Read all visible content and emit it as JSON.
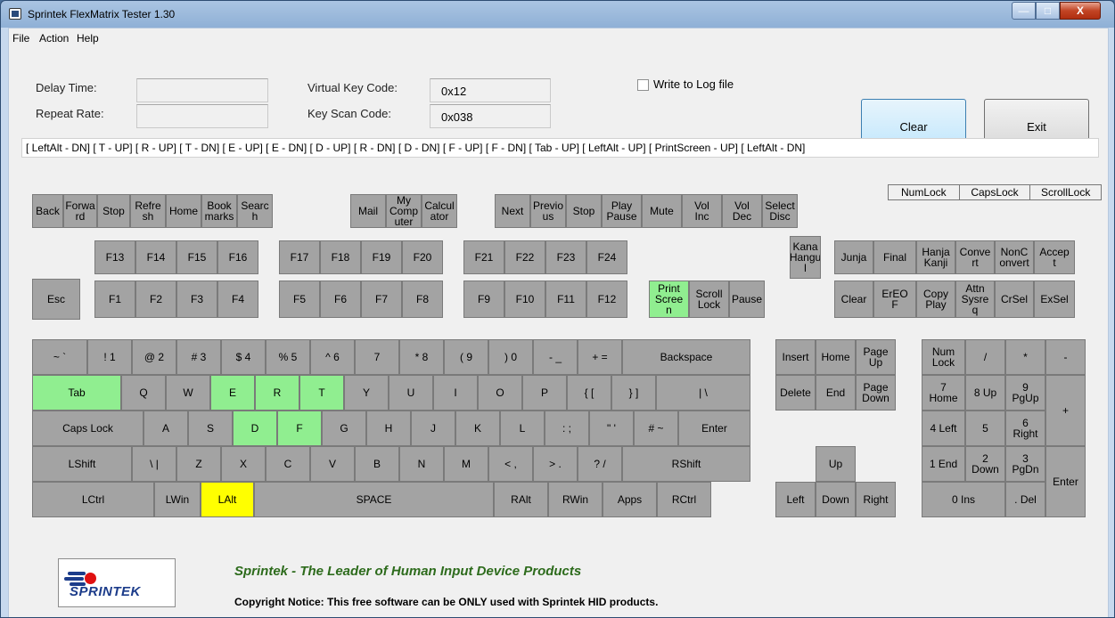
{
  "window": {
    "title": "Sprintek FlexMatrix Tester 1.30",
    "min": "—",
    "max": "□",
    "close": "X"
  },
  "menu": {
    "file": "File",
    "action": "Action",
    "help": "Help"
  },
  "fields": {
    "delay_label": "Delay Time:",
    "delay_value": "",
    "repeat_label": "Repeat Rate:",
    "repeat_value": "",
    "vkey_label": "Virtual Key Code:",
    "vkey_value": "0x12",
    "scan_label": "Key Scan Code:",
    "scan_value": "0x038"
  },
  "log": {
    "label": "Write to Log file",
    "checked": false
  },
  "buttons": {
    "clear": "Clear",
    "exit": "Exit"
  },
  "history": "[ LeftAlt - DN] [ T - UP] [ R - UP] [ T - DN] [ E - UP] [ E - DN] [ D - UP] [ R - DN] [ D - DN] [ F - UP] [ F - DN] [ Tab - UP] [ LeftAlt - UP] [ PrintScreen - UP] [ LeftAlt - DN]",
  "locks": [
    "NumLock",
    "CapsLock",
    "ScrollLock"
  ],
  "footer": {
    "logo_text": "SPRINTEK",
    "tagline": "Sprintek - The Leader of Human Input Device Products",
    "copyright": "Copyright Notice: This free software can be ONLY used with Sprintek HID products."
  },
  "keys": [
    {
      "id": "back",
      "label": "Back",
      "state": "up"
    },
    {
      "id": "forward",
      "label": "Forwa\nrd",
      "state": "up"
    },
    {
      "id": "stop1",
      "label": "Stop",
      "state": "up"
    },
    {
      "id": "refresh",
      "label": "Refre\nsh",
      "state": "up"
    },
    {
      "id": "home-m",
      "label": "Home",
      "state": "up"
    },
    {
      "id": "bookmarks",
      "label": "Book\nmarks",
      "state": "up"
    },
    {
      "id": "search",
      "label": "Searc\nh",
      "state": "up"
    },
    {
      "id": "mail",
      "label": "Mail",
      "state": "up"
    },
    {
      "id": "mycomputer",
      "label": "My\nComp\nuter",
      "state": "up"
    },
    {
      "id": "calculator",
      "label": "Calcul\nator",
      "state": "up"
    },
    {
      "id": "next",
      "label": "Next",
      "state": "up"
    },
    {
      "id": "previous",
      "label": "Previo\nus",
      "state": "up"
    },
    {
      "id": "stop2",
      "label": "Stop",
      "state": "up"
    },
    {
      "id": "playpause",
      "label": "Play\nPause",
      "state": "up"
    },
    {
      "id": "mute",
      "label": "Mute",
      "state": "up"
    },
    {
      "id": "volinc",
      "label": "Vol\nInc",
      "state": "up"
    },
    {
      "id": "voldec",
      "label": "Vol\nDec",
      "state": "up"
    },
    {
      "id": "selectdisc",
      "label": "Select\nDisc",
      "state": "up"
    },
    {
      "id": "f13",
      "label": "F13",
      "state": "up"
    },
    {
      "id": "f14",
      "label": "F14",
      "state": "up"
    },
    {
      "id": "f15",
      "label": "F15",
      "state": "up"
    },
    {
      "id": "f16",
      "label": "F16",
      "state": "up"
    },
    {
      "id": "f17",
      "label": "F17",
      "state": "up"
    },
    {
      "id": "f18",
      "label": "F18",
      "state": "up"
    },
    {
      "id": "f19",
      "label": "F19",
      "state": "up"
    },
    {
      "id": "f20",
      "label": "F20",
      "state": "up"
    },
    {
      "id": "f21",
      "label": "F21",
      "state": "up"
    },
    {
      "id": "f22",
      "label": "F22",
      "state": "up"
    },
    {
      "id": "f23",
      "label": "F23",
      "state": "up"
    },
    {
      "id": "f24",
      "label": "F24",
      "state": "up"
    },
    {
      "id": "kana",
      "label": "Kana\nHangu\nl",
      "state": "up"
    },
    {
      "id": "junja",
      "label": "Junja",
      "state": "up"
    },
    {
      "id": "final",
      "label": "Final",
      "state": "up"
    },
    {
      "id": "hanja",
      "label": "Hanja\nKanji",
      "state": "up"
    },
    {
      "id": "convert",
      "label": "Conve\nrt",
      "state": "up"
    },
    {
      "id": "nonconvert",
      "label": "NonC\nonvert",
      "state": "up"
    },
    {
      "id": "accept",
      "label": "Accep\nt",
      "state": "up"
    },
    {
      "id": "esc",
      "label": "Esc",
      "state": "up"
    },
    {
      "id": "f1",
      "label": "F1",
      "state": "up"
    },
    {
      "id": "f2",
      "label": "F2",
      "state": "up"
    },
    {
      "id": "f3",
      "label": "F3",
      "state": "up"
    },
    {
      "id": "f4",
      "label": "F4",
      "state": "up"
    },
    {
      "id": "f5",
      "label": "F5",
      "state": "up"
    },
    {
      "id": "f6",
      "label": "F6",
      "state": "up"
    },
    {
      "id": "f7",
      "label": "F7",
      "state": "up"
    },
    {
      "id": "f8",
      "label": "F8",
      "state": "up"
    },
    {
      "id": "f9",
      "label": "F9",
      "state": "up"
    },
    {
      "id": "f10",
      "label": "F10",
      "state": "up"
    },
    {
      "id": "f11",
      "label": "F11",
      "state": "up"
    },
    {
      "id": "f12",
      "label": "F12",
      "state": "up"
    },
    {
      "id": "printscreen",
      "label": "Print\nScree\nn",
      "state": "down"
    },
    {
      "id": "scrolllock",
      "label": "Scroll\nLock",
      "state": "up"
    },
    {
      "id": "pause",
      "label": "Pause",
      "state": "up"
    },
    {
      "id": "clearkey",
      "label": "Clear",
      "state": "up"
    },
    {
      "id": "ereof",
      "label": "ErEO\nF",
      "state": "up"
    },
    {
      "id": "copyplay",
      "label": "Copy\nPlay",
      "state": "up"
    },
    {
      "id": "attn",
      "label": "Attn\nSysre\nq",
      "state": "up"
    },
    {
      "id": "crsel",
      "label": "CrSel",
      "state": "up"
    },
    {
      "id": "exsel",
      "label": "ExSel",
      "state": "up"
    },
    {
      "id": "tilde",
      "label": "~ `",
      "state": "up"
    },
    {
      "id": "k1",
      "label": "! 1",
      "state": "up"
    },
    {
      "id": "k2",
      "label": "@ 2",
      "state": "up"
    },
    {
      "id": "k3",
      "label": "# 3",
      "state": "up"
    },
    {
      "id": "k4",
      "label": "$ 4",
      "state": "up"
    },
    {
      "id": "k5",
      "label": "% 5",
      "state": "up"
    },
    {
      "id": "k6",
      "label": "^ 6",
      "state": "up"
    },
    {
      "id": "k7",
      "label": "7",
      "state": "up"
    },
    {
      "id": "k8",
      "label": "* 8",
      "state": "up"
    },
    {
      "id": "k9",
      "label": "( 9",
      "state": "up"
    },
    {
      "id": "k0",
      "label": ") 0",
      "state": "up"
    },
    {
      "id": "minus",
      "label": "- _",
      "state": "up"
    },
    {
      "id": "equals",
      "label": "+ =",
      "state": "up"
    },
    {
      "id": "backspace",
      "label": "Backspace",
      "state": "up"
    },
    {
      "id": "insert",
      "label": "Insert",
      "state": "up"
    },
    {
      "id": "home",
      "label": "Home",
      "state": "up"
    },
    {
      "id": "pageup",
      "label": "Page\nUp",
      "state": "up"
    },
    {
      "id": "numlock",
      "label": "Num\nLock",
      "state": "up"
    },
    {
      "id": "npdiv",
      "label": "/",
      "state": "up"
    },
    {
      "id": "npmul",
      "label": "*",
      "state": "up"
    },
    {
      "id": "npminus",
      "label": "-",
      "state": "up"
    },
    {
      "id": "tab",
      "label": "Tab",
      "state": "down"
    },
    {
      "id": "q",
      "label": "Q",
      "state": "up"
    },
    {
      "id": "w",
      "label": "W",
      "state": "up"
    },
    {
      "id": "e",
      "label": "E",
      "state": "down"
    },
    {
      "id": "r",
      "label": "R",
      "state": "down"
    },
    {
      "id": "t",
      "label": "T",
      "state": "down"
    },
    {
      "id": "y",
      "label": "Y",
      "state": "up"
    },
    {
      "id": "u",
      "label": "U",
      "state": "up"
    },
    {
      "id": "i",
      "label": "I",
      "state": "up"
    },
    {
      "id": "o",
      "label": "O",
      "state": "up"
    },
    {
      "id": "p",
      "label": "P",
      "state": "up"
    },
    {
      "id": "lbracket",
      "label": "{ [",
      "state": "up"
    },
    {
      "id": "rbracket",
      "label": "} ]",
      "state": "up"
    },
    {
      "id": "backslash",
      "label": "| \\",
      "state": "up"
    },
    {
      "id": "delete",
      "label": "Delete",
      "state": "up"
    },
    {
      "id": "end",
      "label": "End",
      "state": "up"
    },
    {
      "id": "pagedown",
      "label": "Page\nDown",
      "state": "up"
    },
    {
      "id": "np7",
      "label": "7\nHome",
      "state": "up"
    },
    {
      "id": "np8",
      "label": "8 Up",
      "state": "up"
    },
    {
      "id": "np9",
      "label": "9\nPgUp",
      "state": "up"
    },
    {
      "id": "npplus",
      "label": "+",
      "state": "up"
    },
    {
      "id": "capslock",
      "label": "Caps Lock",
      "state": "up"
    },
    {
      "id": "a",
      "label": "A",
      "state": "up"
    },
    {
      "id": "s",
      "label": "S",
      "state": "up"
    },
    {
      "id": "d",
      "label": "D",
      "state": "down"
    },
    {
      "id": "f",
      "label": "F",
      "state": "down"
    },
    {
      "id": "g",
      "label": "G",
      "state": "up"
    },
    {
      "id": "h",
      "label": "H",
      "state": "up"
    },
    {
      "id": "j",
      "label": "J",
      "state": "up"
    },
    {
      "id": "k",
      "label": "K",
      "state": "up"
    },
    {
      "id": "l",
      "label": "L",
      "state": "up"
    },
    {
      "id": "semicolon",
      "label": ": ;",
      "state": "up"
    },
    {
      "id": "quote",
      "label": "\" '",
      "state": "up"
    },
    {
      "id": "hash",
      "label": "# ~",
      "state": "up"
    },
    {
      "id": "enter",
      "label": "Enter",
      "state": "up"
    },
    {
      "id": "np4",
      "label": "4 Left",
      "state": "up"
    },
    {
      "id": "np5",
      "label": "5",
      "state": "up"
    },
    {
      "id": "np6",
      "label": "6\nRight",
      "state": "up"
    },
    {
      "id": "lshift",
      "label": "LShift",
      "state": "up"
    },
    {
      "id": "intlbackslash",
      "label": "\\ |",
      "state": "up"
    },
    {
      "id": "z",
      "label": "Z",
      "state": "up"
    },
    {
      "id": "x",
      "label": "X",
      "state": "up"
    },
    {
      "id": "c",
      "label": "C",
      "state": "up"
    },
    {
      "id": "v",
      "label": "V",
      "state": "up"
    },
    {
      "id": "b",
      "label": "B",
      "state": "up"
    },
    {
      "id": "n",
      "label": "N",
      "state": "up"
    },
    {
      "id": "m",
      "label": "M",
      "state": "up"
    },
    {
      "id": "comma",
      "label": "< ,",
      "state": "up"
    },
    {
      "id": "period",
      "label": "> .",
      "state": "up"
    },
    {
      "id": "slash",
      "label": "? /",
      "state": "up"
    },
    {
      "id": "rshift",
      "label": "RShift",
      "state": "up"
    },
    {
      "id": "up",
      "label": "Up",
      "state": "up"
    },
    {
      "id": "np1",
      "label": "1 End",
      "state": "up"
    },
    {
      "id": "np2",
      "label": "2\nDown",
      "state": "up"
    },
    {
      "id": "np3",
      "label": "3\nPgDn",
      "state": "up"
    },
    {
      "id": "npenter",
      "label": "Enter",
      "state": "up"
    },
    {
      "id": "lctrl",
      "label": "LCtrl",
      "state": "up"
    },
    {
      "id": "lwin",
      "label": "LWin",
      "state": "up"
    },
    {
      "id": "lalt",
      "label": "LAlt",
      "state": "active"
    },
    {
      "id": "space",
      "label": "SPACE",
      "state": "up"
    },
    {
      "id": "ralt",
      "label": "RAlt",
      "state": "up"
    },
    {
      "id": "rwin",
      "label": "RWin",
      "state": "up"
    },
    {
      "id": "apps",
      "label": "Apps",
      "state": "up"
    },
    {
      "id": "rctrl",
      "label": "RCtrl",
      "state": "up"
    },
    {
      "id": "left",
      "label": "Left",
      "state": "up"
    },
    {
      "id": "down",
      "label": "Down",
      "state": "up"
    },
    {
      "id": "right",
      "label": "Right",
      "state": "up"
    },
    {
      "id": "np0",
      "label": "0 Ins",
      "state": "up"
    },
    {
      "id": "npdel",
      "label": ". Del",
      "state": "up"
    }
  ]
}
